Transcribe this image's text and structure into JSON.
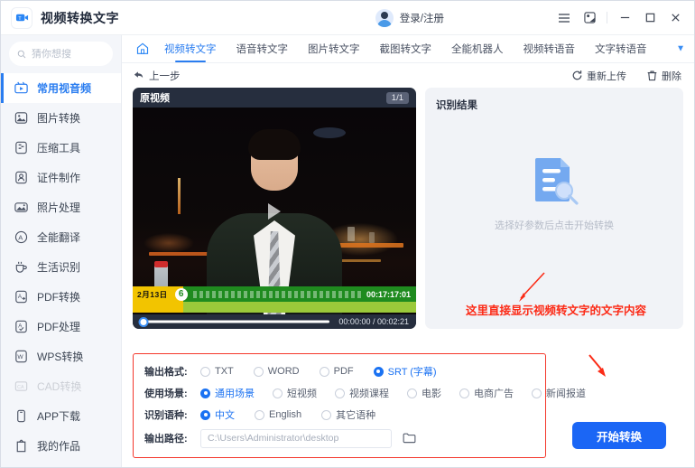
{
  "titlebar": {
    "app_title": "视频转换文字",
    "logo_icon": "video-camera-icon",
    "account_label": "登录/注册",
    "avatar_icon": "user-avatar",
    "menu_icon": "hamburger-menu-icon",
    "theme_icon": "skin-theme-icon",
    "minimize_icon": "minimize-icon",
    "maximize_icon": "maximize-icon",
    "close_icon": "close-icon"
  },
  "sidebar": {
    "search": {
      "placeholder": "猜你想搜",
      "icon": "search-icon",
      "value": ""
    },
    "items": [
      {
        "label": "常用视音频",
        "icon": "video-icon",
        "active": true
      },
      {
        "label": "图片转换",
        "icon": "image-icon",
        "active": false
      },
      {
        "label": "压缩工具",
        "icon": "compress-icon",
        "active": false
      },
      {
        "label": "证件制作",
        "icon": "id-card-icon",
        "active": false
      },
      {
        "label": "照片处理",
        "icon": "photo-edit-icon",
        "active": false
      },
      {
        "label": "全能翻译",
        "icon": "translate-icon",
        "active": false
      },
      {
        "label": "生活识别",
        "icon": "cup-icon",
        "active": false
      },
      {
        "label": "PDF转换",
        "icon": "pdf-convert-icon",
        "active": false
      },
      {
        "label": "PDF处理",
        "icon": "pdf-edit-icon",
        "active": false
      },
      {
        "label": "WPS转换",
        "icon": "wps-icon",
        "active": false
      },
      {
        "label": "CAD转换",
        "icon": "cad-icon",
        "active": false
      },
      {
        "label": "APP下载",
        "icon": "phone-download-icon",
        "active": false
      },
      {
        "label": "我的作品",
        "icon": "clipboard-icon",
        "active": false
      }
    ]
  },
  "tabbar": {
    "home_icon": "home-icon",
    "expand_icon": "chevron-down-icon",
    "tabs": [
      {
        "label": "视频转文字",
        "active": true
      },
      {
        "label": "语音转文字",
        "active": false
      },
      {
        "label": "图片转文字",
        "active": false
      },
      {
        "label": "截图转文字",
        "active": false
      },
      {
        "label": "全能机器人",
        "active": false
      },
      {
        "label": "视频转语音",
        "active": false
      },
      {
        "label": "文字转语音",
        "active": false
      }
    ]
  },
  "subbar": {
    "back_label": "上一步",
    "back_icon": "arrow-back-icon",
    "reupload_label": "重新上传",
    "reupload_icon": "refresh-icon",
    "delete_label": "删除",
    "delete_icon": "trash-icon"
  },
  "video_panel": {
    "title": "原视频",
    "page_badge": "1/1",
    "current_time": "00:00:00",
    "total_time": "00:02:21",
    "time_display": "00:00:00 / 00:02:21",
    "progress_percent": 0,
    "play_icon": "play-triangle-icon",
    "overlay_date": "2月13日",
    "overlay_channel": "6",
    "overlay_clock": "00:17:17:01"
  },
  "result_panel": {
    "title": "识别结果",
    "empty_icon": "document-search-icon",
    "empty_text": "选择好参数后点击开始转换",
    "annotation": "这里直接显示视频转文字的文字内容"
  },
  "options": {
    "format": {
      "label": "输出格式:",
      "choices": [
        {
          "label": "TXT",
          "selected": false
        },
        {
          "label": "WORD",
          "selected": false
        },
        {
          "label": "PDF",
          "selected": false
        },
        {
          "label": "SRT (字幕)",
          "selected": true
        }
      ]
    },
    "scene": {
      "label": "使用场景:",
      "choices": [
        {
          "label": "通用场景",
          "selected": true
        },
        {
          "label": "短视频",
          "selected": false
        },
        {
          "label": "视频课程",
          "selected": false
        },
        {
          "label": "电影",
          "selected": false
        },
        {
          "label": "电商广告",
          "selected": false
        },
        {
          "label": "新闻报道",
          "selected": false
        }
      ]
    },
    "language": {
      "label": "识别语种:",
      "choices": [
        {
          "label": "中文",
          "selected": true
        },
        {
          "label": "English",
          "selected": false
        },
        {
          "label": "其它语种",
          "selected": false
        }
      ]
    },
    "output_path": {
      "label": "输出路径:",
      "value": "C:\\Users\\Administrator\\desktop",
      "browse_icon": "folder-icon"
    }
  },
  "action": {
    "start_label": "开始转换",
    "arrow_icon": "red-arrow-icon"
  },
  "colors": {
    "accent": "#1b66f5",
    "annotation_red": "#fc2a16",
    "sidebar_bg": "#f4f6fa",
    "panel_bg": "#f1f3f7"
  }
}
